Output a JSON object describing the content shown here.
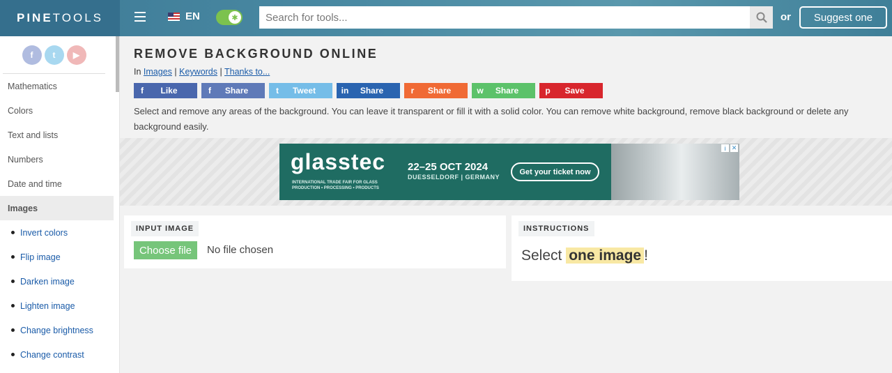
{
  "header": {
    "logo_bold": "PINE",
    "logo_thin": "TOOLS",
    "lang": "EN",
    "search_placeholder": "Search for tools...",
    "or_text": "or",
    "suggest_label": "Suggest one"
  },
  "sidebar": {
    "socials": [
      "f",
      "t",
      "▶"
    ],
    "items": [
      {
        "label": "Mathematics"
      },
      {
        "label": "Colors"
      },
      {
        "label": "Text and lists"
      },
      {
        "label": "Numbers"
      },
      {
        "label": "Date and time"
      },
      {
        "label": "Images"
      },
      {
        "label": "Invert colors"
      },
      {
        "label": "Flip image"
      },
      {
        "label": "Darken image"
      },
      {
        "label": "Lighten image"
      },
      {
        "label": "Change brightness"
      },
      {
        "label": "Change contrast"
      }
    ]
  },
  "page": {
    "title": "REMOVE BACKGROUND ONLINE",
    "crumb_prefix": "In",
    "crumbs": [
      "Images",
      "Keywords",
      "Thanks to..."
    ],
    "share_buttons": [
      {
        "icon": "f",
        "label": "Like",
        "color": "#4a67ad"
      },
      {
        "icon": "f",
        "label": "Share",
        "color": "#5f7ab8"
      },
      {
        "icon": "t",
        "label": "Tweet",
        "color": "#75bde8"
      },
      {
        "icon": "in",
        "label": "Share",
        "color": "#2a64b0"
      },
      {
        "icon": "r",
        "label": "Share",
        "color": "#f06a35"
      },
      {
        "icon": "w",
        "label": "Share",
        "color": "#5cc26a"
      },
      {
        "icon": "p",
        "label": "Save",
        "color": "#d8262d"
      }
    ],
    "description": "Select and remove any areas of the background. You can leave it transparent or fill it with a solid color. You can remove white background, remove black background or delete any background easily."
  },
  "ad": {
    "brand": "glasstec",
    "tagline": "INTERNATIONAL TRADE FAIR FOR GLASS PRODUCTION • PROCESSING • PRODUCTS",
    "date": "22–25 OCT 2024",
    "city": "DUESSELDORF | GERMANY",
    "cta": "Get your ticket now"
  },
  "input_panel": {
    "title": "INPUT IMAGE",
    "choose_label": "Choose file",
    "no_file": "No file chosen"
  },
  "instructions_panel": {
    "title": "INSTRUCTIONS",
    "text_before": "Select",
    "highlight": "one image",
    "text_after": "!"
  }
}
